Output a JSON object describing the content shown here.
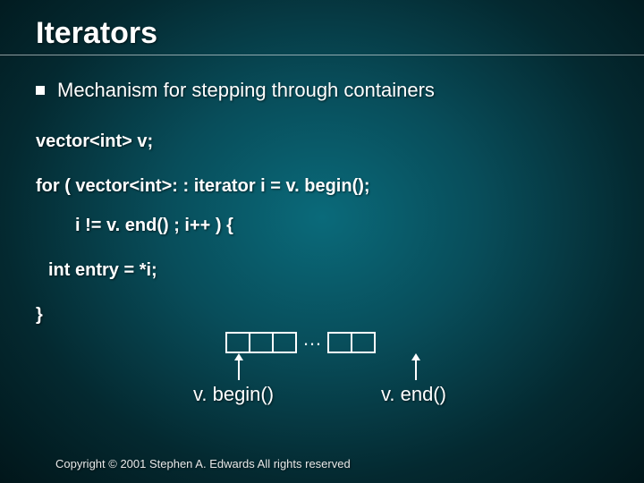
{
  "title": "Iterators",
  "bullet": "Mechanism for stepping through containers",
  "code": {
    "l0": "vector<int> v;",
    "l1": "for ( vector<int>: : iterator i = v. begin();",
    "l2": "i != v. end() ; i++ ) {",
    "l3": "int entry = *i;",
    "l4": "}"
  },
  "diagram": {
    "dots": "…",
    "begin_label": "v. begin()",
    "end_label": "v. end()"
  },
  "footer": "Copyright © 2001 Stephen A. Edwards  All rights reserved"
}
